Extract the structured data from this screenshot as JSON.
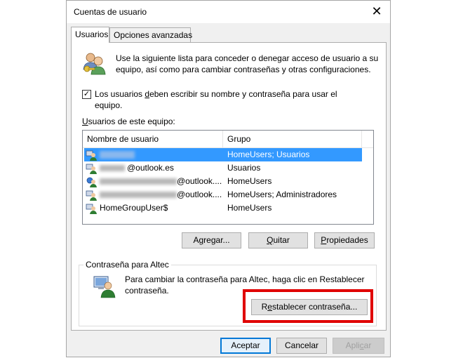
{
  "window": {
    "title": "Cuentas de usuario",
    "close_icon": "✕"
  },
  "tabs": [
    {
      "label": "Usuarios",
      "active": true
    },
    {
      "label": "Opciones avanzadas",
      "active": false
    }
  ],
  "intro": {
    "line1": "Use la siguiente lista para conceder o denegar acceso de usuario a su",
    "line2": "equipo, así como para cambiar contraseñas y otras configuraciones."
  },
  "require_login": {
    "checked": true,
    "check_mark": "✓",
    "label_prefix": "Los usuarios ",
    "label_accel": "d",
    "label_rest": "eben escribir su nombre y contraseña para usar el",
    "label_line2": "equipo."
  },
  "users_list": {
    "label_accel": "U",
    "label_rest": "suarios de este equipo:",
    "columns": [
      "Nombre de usuario",
      "Grupo"
    ],
    "rows": [
      {
        "name": "",
        "group": "HomeUsers; Usuarios",
        "selected": true,
        "blurred": true
      },
      {
        "name": "@outlook.es",
        "group": "Usuarios",
        "selected": false,
        "blurred": true
      },
      {
        "name": "@outlook....",
        "group": "HomeUsers",
        "selected": false,
        "blurred": true
      },
      {
        "name": "@outlook....",
        "group": "HomeUsers; Administradores",
        "selected": false,
        "blurred": true
      },
      {
        "name": "HomeGroupUser$",
        "group": "HomeUsers",
        "selected": false,
        "blurred": false
      }
    ]
  },
  "list_buttons": {
    "add": {
      "accel": "g",
      "pre": "A",
      "post": "regar..."
    },
    "remove": {
      "accel": "Q",
      "pre": "",
      "post": "uitar"
    },
    "properties": {
      "accel": "P",
      "pre": "",
      "post": "ropiedades"
    }
  },
  "password_group": {
    "title": "Contraseña para Altec",
    "text_line1": "Para cambiar la contraseña para Altec, haga clic en Restablecer",
    "text_line2": "contraseña.",
    "reset_button": {
      "pre": "R",
      "accel": "e",
      "post": "stablecer contraseña..."
    }
  },
  "footer": {
    "ok": "Aceptar",
    "cancel": "Cancelar",
    "apply": {
      "pre": "Apli",
      "accel": "c",
      "post": "ar"
    }
  },
  "colors": {
    "selection": "#3399ff",
    "highlight_box": "#e00000",
    "primary_border": "#0078d7"
  }
}
